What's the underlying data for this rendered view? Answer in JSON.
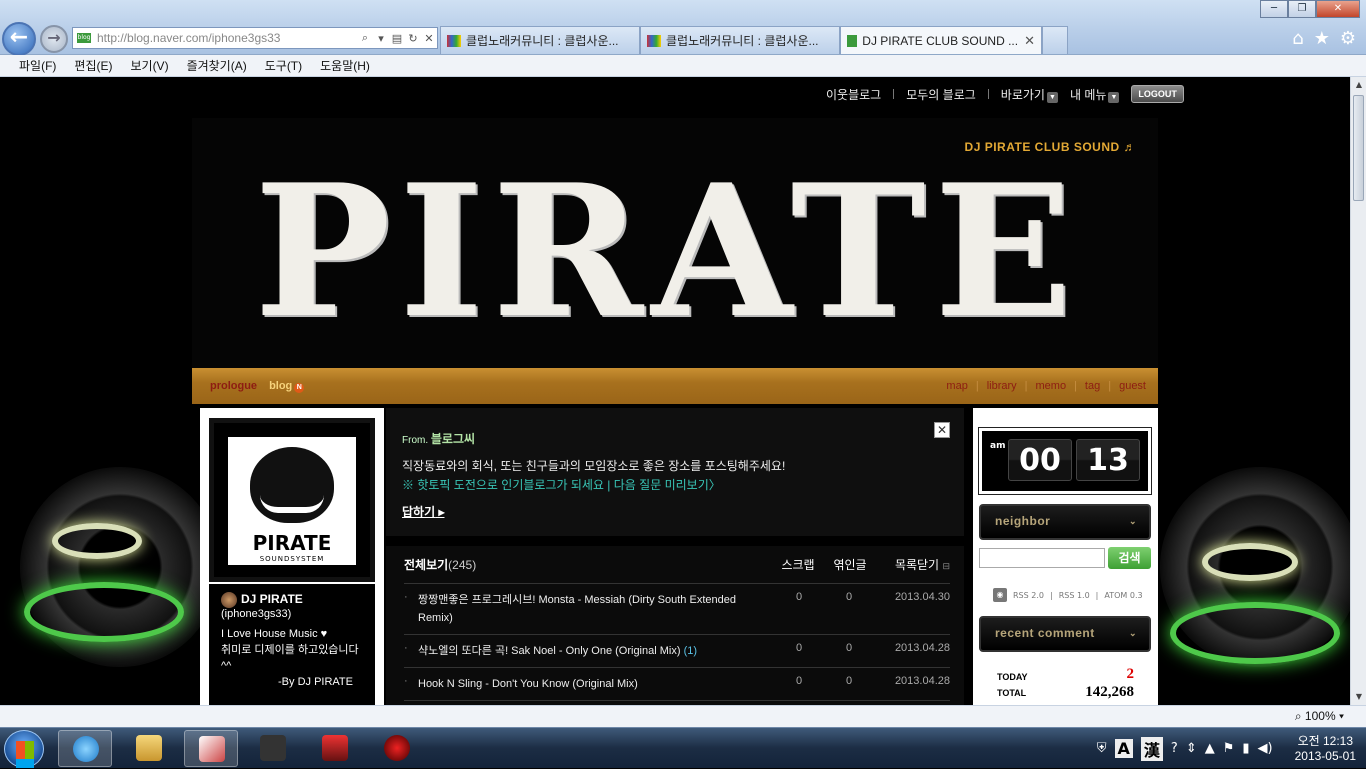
{
  "browser": {
    "url_host": "http://blog.naver.com",
    "url_path": "/iphone3gs33",
    "tabs": [
      {
        "label": "클럽노래커뮤니티 : 클럽사운..."
      },
      {
        "label": "클럽노래커뮤니티 : 클럽사운..."
      },
      {
        "label": "DJ PIRATE CLUB SOUND ..."
      }
    ],
    "menu": [
      "파일(F)",
      "편집(E)",
      "보기(V)",
      "즐겨찾기(A)",
      "도구(T)",
      "도움말(H)"
    ],
    "zoom": "100%"
  },
  "blog": {
    "top_links": {
      "neighbor_blog": "이웃블로그",
      "all_blog": "모두의 블로그",
      "goto": "바로가기",
      "my_menu": "내 메뉴",
      "logout": "LOGOUT"
    },
    "title": "DJ PIRATE CLUB SOUND ♬",
    "logo_text": "PIRATE",
    "nav_left": {
      "prologue": "prologue",
      "blog": "blog",
      "new_badge": "N"
    },
    "nav_right": [
      "map",
      "library",
      "memo",
      "tag",
      "guest"
    ],
    "profile": {
      "logo_word": "PIRATE",
      "logo_sub": "SOUNDSYSTEM",
      "nickname": "DJ PIRATE",
      "user_id": "(iphone3gs33)",
      "bio1": "I Love House Music ♥",
      "bio2": "취미로 디제이를 하고있습니다^^",
      "bio3": "-By DJ PIRATE"
    },
    "notice": {
      "from_label": "From.",
      "from_name": "블로그씨",
      "text": "직장동료와의 회식, 또는 친구들과의 모임장소로 좋은 장소를 포스팅해주세요!",
      "links": "※ 핫토픽 도전으로 인기블로그가 되세요 | 다음 질문 미리보기〉",
      "reply": "답하기"
    },
    "list": {
      "title": "전체보기",
      "count": "(245)",
      "headers": {
        "scrap": "스크랩",
        "sympathy": "엮인글",
        "close": "목록닫기"
      },
      "rows": [
        {
          "title": "짱짱맨좋은 프로그레시브! Monsta - Messiah (Dirty South Extended Remix)",
          "comments": "",
          "scrap": "0",
          "trackback": "0",
          "date": "2013.04.30"
        },
        {
          "title": "샥노엘의 또다른 곡! Sak Noel - Only One (Original Mix)",
          "comments": "(1)",
          "scrap": "0",
          "trackback": "0",
          "date": "2013.04.28"
        },
        {
          "title": "Hook N Sling - Don't You Know (Original Mix)",
          "comments": "",
          "scrap": "0",
          "trackback": "0",
          "date": "2013.04.28"
        }
      ]
    },
    "clock": {
      "ampm": "am",
      "hour": "00",
      "minute": "13"
    },
    "sidebar": {
      "neighbor": "neighbor",
      "search_btn": "검색",
      "rss": [
        "RSS 2.0",
        "RSS 1.0",
        "ATOM 0.3"
      ],
      "recent_comment": "recent comment",
      "today_label": "TODAY",
      "today_value": "2",
      "total_label": "TOTAL",
      "total_value": "142,268"
    }
  },
  "taskbar": {
    "time": "오전 12:13",
    "date": "2013-05-01",
    "ime": "A",
    "hanja": "漢"
  },
  "colors": {
    "accent_gold": "#e3a935",
    "nav_red": "#8e1d12",
    "search_green": "#3ea034"
  }
}
